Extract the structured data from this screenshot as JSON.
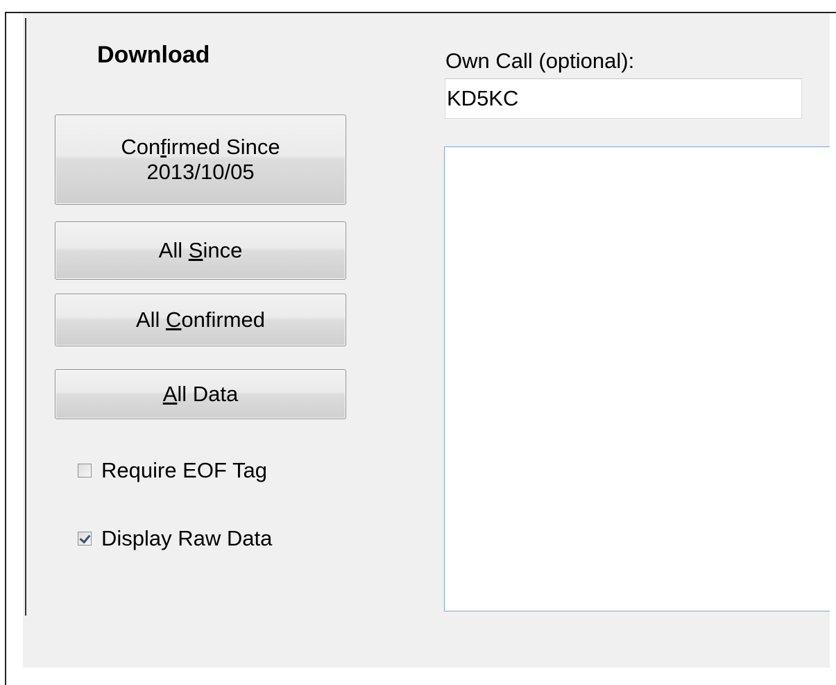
{
  "download": {
    "title": "Download",
    "confirmed_since": {
      "line1_pre": "Con",
      "line1_u": "f",
      "line1_post": "irmed Since",
      "line2": "2013/10/05"
    },
    "all_since": {
      "pre": "All ",
      "u": "S",
      "post": "ince"
    },
    "all_confirmed": {
      "pre": "All ",
      "u": "C",
      "post": "onfirmed"
    },
    "all_data": {
      "pre": "",
      "u": "A",
      "post": "ll Data"
    },
    "require_eof": {
      "label": "Require EOF Tag",
      "checked": false
    },
    "display_raw": {
      "label": "Display Raw Data",
      "checked": true
    }
  },
  "own_call": {
    "label": "Own Call (optional):",
    "value": "KD5KC"
  },
  "raw_output": {
    "text": ""
  },
  "colors": {
    "panel": "#f0f0f0",
    "focus_border": "#7aa7d8",
    "check_mark": "#3a4d7a"
  }
}
